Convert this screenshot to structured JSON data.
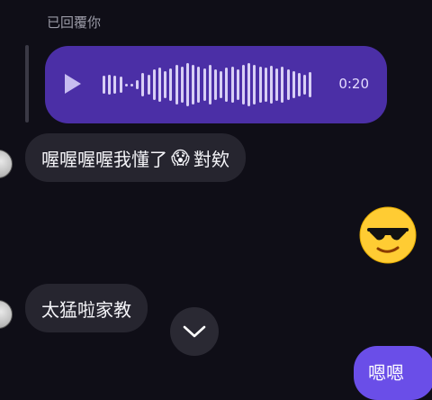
{
  "reply": {
    "label": "已回覆你"
  },
  "voice_message": {
    "duration": "0:20",
    "play_icon": "play-icon"
  },
  "messages": [
    {
      "text": "喔喔喔喔我懂了",
      "emoji": "😱",
      "suffix": "對欸"
    },
    {
      "text": "太猛啦家教"
    }
  ],
  "sticker": {
    "emoji": "😎"
  },
  "outgoing_partial": {
    "text": "嗯嗯"
  },
  "scroll_button": {
    "icon": "chevron-down-icon"
  },
  "colors": {
    "background": "#0f0e17",
    "voice_bubble": "#4b2fa6",
    "incoming_bubble": "#26252f",
    "outgoing_bubble": "#6a4ee8"
  }
}
